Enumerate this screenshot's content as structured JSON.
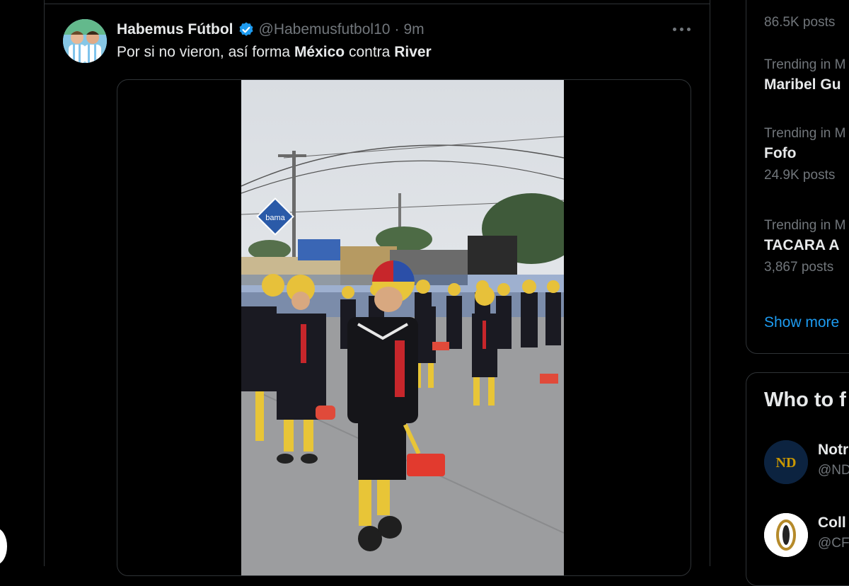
{
  "tweet": {
    "display_name": "Habemus Fútbol",
    "handle": "@Habemusfutbol10",
    "separator": "·",
    "time": "9m",
    "text_parts": [
      "Por si no vieron, así forma ",
      "México",
      " contra ",
      "River"
    ],
    "video_sign_text": "bama"
  },
  "sidebar": {
    "trends": [
      {
        "meta": "",
        "name": "",
        "count": "86.5K posts"
      },
      {
        "meta": "Trending in M",
        "name": "Maribel Gu",
        "count": ""
      },
      {
        "meta": "Trending in M",
        "name": "Fofo",
        "count": "24.9K posts"
      },
      {
        "meta": "Trending in M",
        "name": "TACARA A",
        "count": "3,867 posts"
      }
    ],
    "show_more": "Show more",
    "who_to_follow": {
      "title": "Who to f",
      "accounts": [
        {
          "name": "Notr",
          "handle": "@ND"
        },
        {
          "name": "Coll",
          "handle": "@CF"
        }
      ]
    }
  },
  "colors": {
    "background": "#000000",
    "border": "#2f3336",
    "text_primary": "#e7e9ea",
    "text_secondary": "#71767b",
    "accent_blue": "#1d9bf0"
  },
  "icons": {
    "verified": "verified-badge-icon",
    "more": "more-dots-icon"
  }
}
